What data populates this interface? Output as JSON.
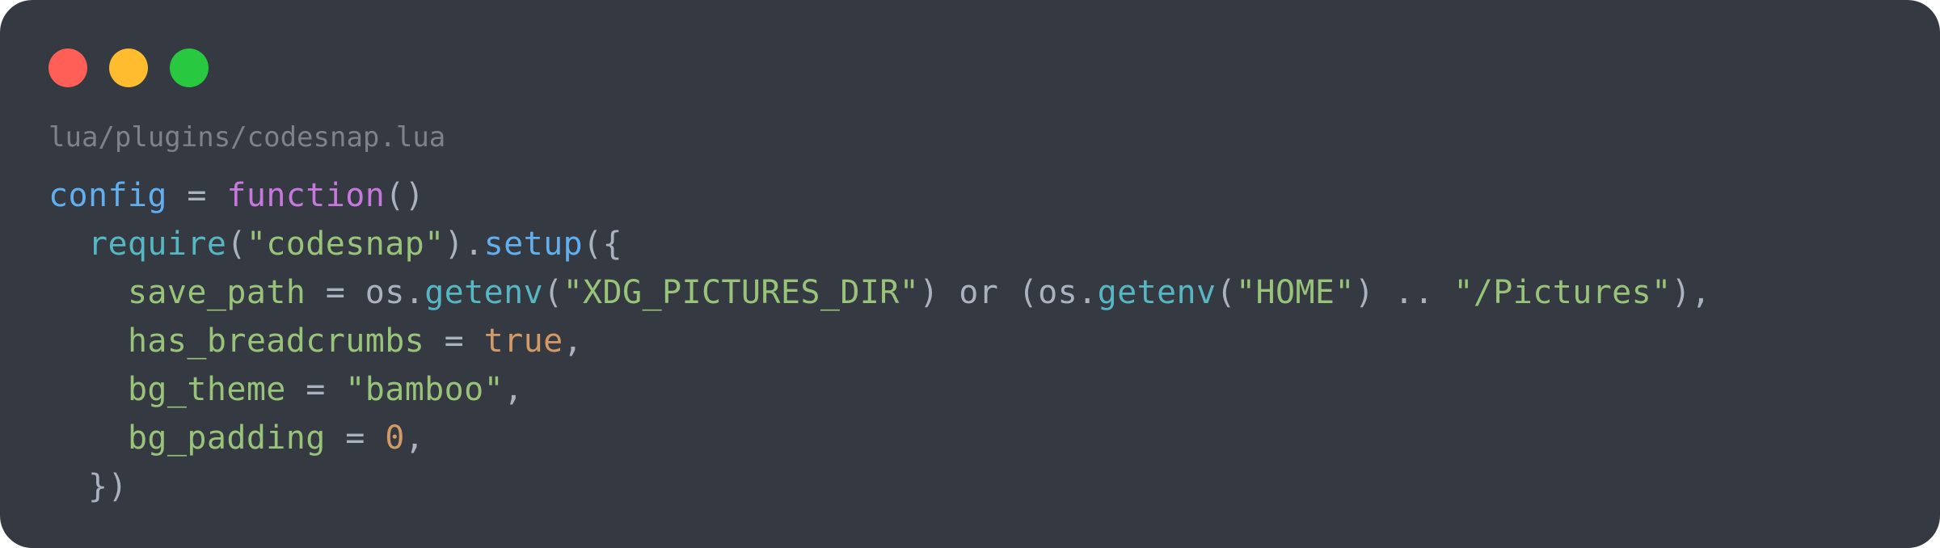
{
  "window": {
    "background": "#343942",
    "controls": [
      {
        "name": "close-dot",
        "color": "#ff5f57"
      },
      {
        "name": "minimize-dot",
        "color": "#febc2e"
      },
      {
        "name": "maximize-dot",
        "color": "#28c840"
      }
    ]
  },
  "breadcrumb": "lua/plugins/codesnap.lua",
  "colors": {
    "default": "#abb2bf",
    "variable": "#61afef",
    "keyword": "#c678dd",
    "call": "#56b6c2",
    "string": "#98c379",
    "field": "#98c379",
    "boolean": "#d19a66",
    "number": "#d19a66"
  },
  "code_lines": [
    [
      {
        "text": "config",
        "style": "variable"
      },
      {
        "text": " = ",
        "style": "default"
      },
      {
        "text": "function",
        "style": "keyword"
      },
      {
        "text": "()",
        "style": "default"
      }
    ],
    [
      {
        "text": "  ",
        "style": "default"
      },
      {
        "text": "require",
        "style": "call"
      },
      {
        "text": "(",
        "style": "default"
      },
      {
        "text": "\"codesnap\"",
        "style": "string"
      },
      {
        "text": ").",
        "style": "default"
      },
      {
        "text": "setup",
        "style": "variable"
      },
      {
        "text": "({",
        "style": "default"
      }
    ],
    [
      {
        "text": "    ",
        "style": "default"
      },
      {
        "text": "save_path",
        "style": "field"
      },
      {
        "text": " = os.",
        "style": "default"
      },
      {
        "text": "getenv",
        "style": "call"
      },
      {
        "text": "(",
        "style": "default"
      },
      {
        "text": "\"XDG_PICTURES_DIR\"",
        "style": "string"
      },
      {
        "text": ") or (os.",
        "style": "default"
      },
      {
        "text": "getenv",
        "style": "call"
      },
      {
        "text": "(",
        "style": "default"
      },
      {
        "text": "\"HOME\"",
        "style": "string"
      },
      {
        "text": ") .. ",
        "style": "default"
      },
      {
        "text": "\"/Pictures\"",
        "style": "string"
      },
      {
        "text": "),",
        "style": "default"
      }
    ],
    [
      {
        "text": "    ",
        "style": "default"
      },
      {
        "text": "has_breadcrumbs",
        "style": "field"
      },
      {
        "text": " = ",
        "style": "default"
      },
      {
        "text": "true",
        "style": "boolean"
      },
      {
        "text": ",",
        "style": "default"
      }
    ],
    [
      {
        "text": "    ",
        "style": "default"
      },
      {
        "text": "bg_theme",
        "style": "field"
      },
      {
        "text": " = ",
        "style": "default"
      },
      {
        "text": "\"bamboo\"",
        "style": "string"
      },
      {
        "text": ",",
        "style": "default"
      }
    ],
    [
      {
        "text": "    ",
        "style": "default"
      },
      {
        "text": "bg_padding",
        "style": "field"
      },
      {
        "text": " = ",
        "style": "default"
      },
      {
        "text": "0",
        "style": "number"
      },
      {
        "text": ",",
        "style": "default"
      }
    ],
    [
      {
        "text": "  })",
        "style": "default"
      }
    ]
  ]
}
